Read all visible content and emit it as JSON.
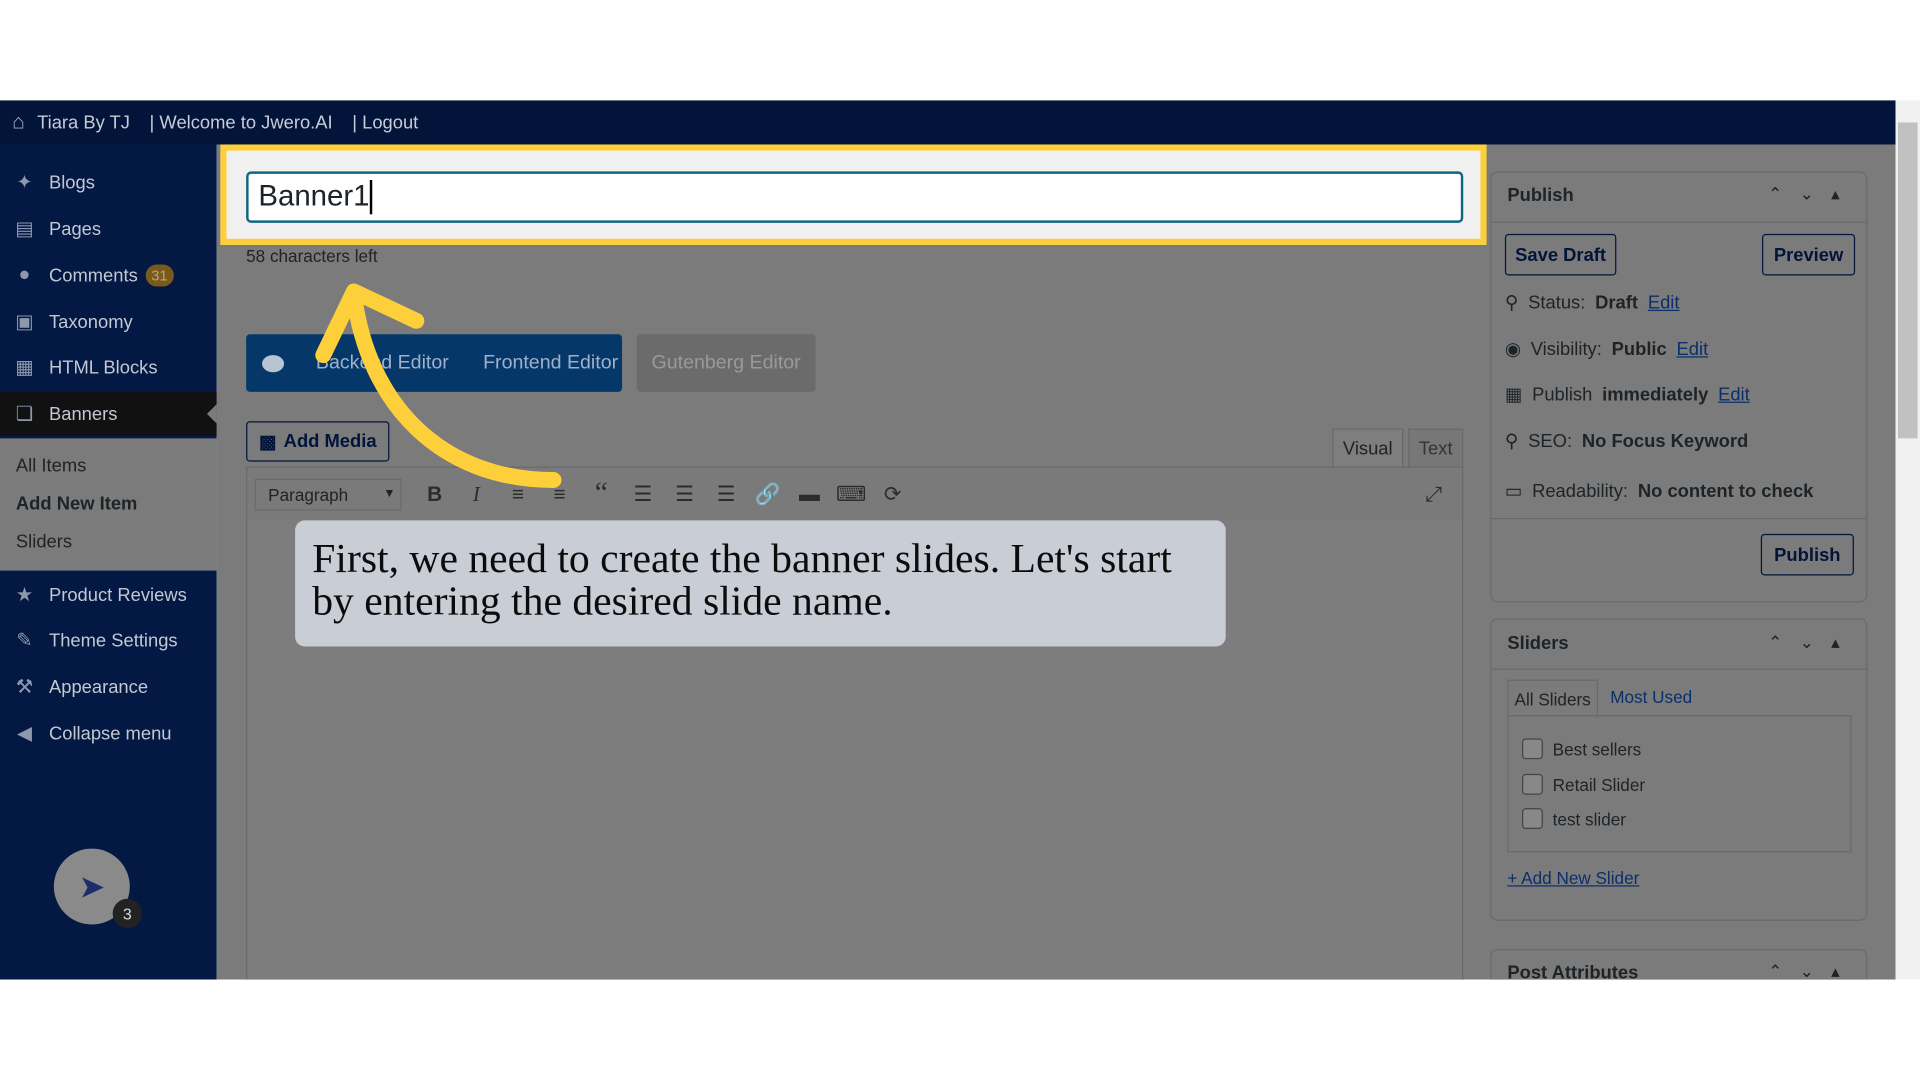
{
  "adminbar": {
    "site": "Tiara By TJ",
    "welcome": "| Welcome to Jwero.AI",
    "logout": "| Logout"
  },
  "sidebar": {
    "items": [
      {
        "label": "Blogs",
        "icon": "pin-icon"
      },
      {
        "label": "Pages",
        "icon": "pages-icon"
      },
      {
        "label": "Comments",
        "icon": "comment-icon",
        "badge": "31"
      },
      {
        "label": "Taxonomy",
        "icon": "archive-icon"
      },
      {
        "label": "HTML Blocks",
        "icon": "code-icon"
      },
      {
        "label": "Banners",
        "icon": "banners-icon"
      },
      {
        "label": "Product Reviews",
        "icon": "star-icon"
      },
      {
        "label": "Theme Settings",
        "icon": "brush-icon"
      },
      {
        "label": "Appearance",
        "icon": "hammer-icon"
      },
      {
        "label": "Collapse menu",
        "icon": "collapse-icon"
      }
    ],
    "submenu": [
      "All Items",
      "Add New Item",
      "Sliders"
    ],
    "avatar_badge": "3"
  },
  "editor": {
    "title_value": "Banner1",
    "chars_left": "58 characters left",
    "builder": {
      "backend": "Backend Editor",
      "frontend": "Frontend Editor",
      "gutenberg": "Gutenberg Editor"
    },
    "add_media": "Add Media",
    "tabs": {
      "visual": "Visual",
      "text": "Text"
    },
    "format": "Paragraph"
  },
  "tooltip": "First, we need to create the banner slides. Let's start by entering the desired slide name.",
  "publish": {
    "title": "Publish",
    "save_draft": "Save Draft",
    "preview": "Preview",
    "status_label": "Status:",
    "status": "Draft",
    "visibility_label": "Visibility:",
    "visibility": "Public",
    "publish_label": "Publish",
    "publish_when": "immediately",
    "edit": "Edit",
    "seo_label": "SEO:",
    "seo": "No Focus Keyword",
    "read_label": "Readability:",
    "read": "No content to check",
    "publish_btn": "Publish"
  },
  "sliders": {
    "title": "Sliders",
    "tab_all": "All Sliders",
    "tab_used": "Most Used",
    "items": [
      "Best sellers",
      "Retail Slider",
      "test slider"
    ],
    "add": "+ Add New Slider"
  },
  "attributes": {
    "title": "Post Attributes"
  },
  "colors": {
    "highlight": "#fdd03b",
    "adminbar": "#02143a",
    "accent": "#053769"
  }
}
